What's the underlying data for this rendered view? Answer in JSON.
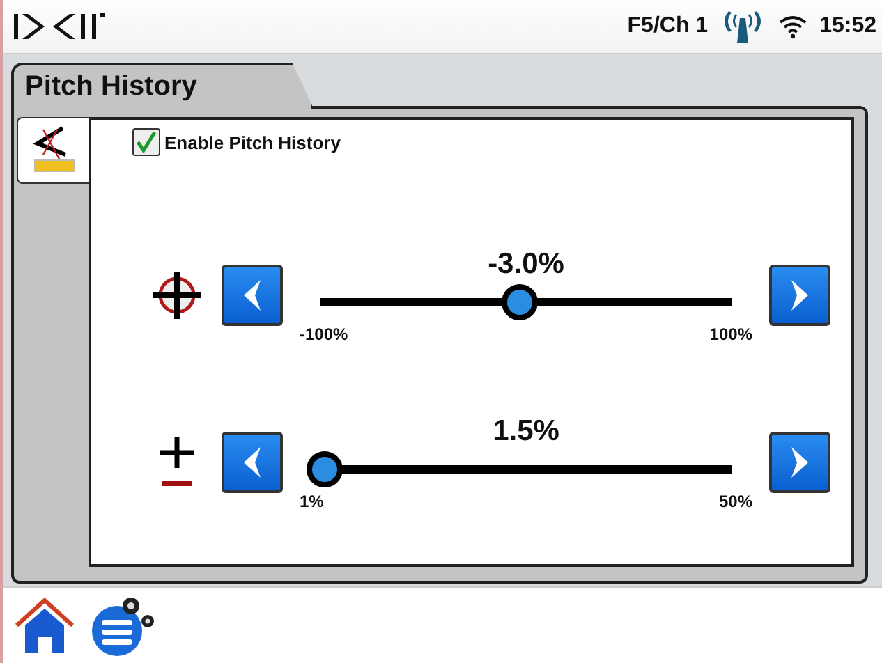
{
  "status_bar": {
    "channel": "F5/Ch 1",
    "time": "15:52"
  },
  "tab": {
    "title": "Pitch History"
  },
  "enable": {
    "label": "Enable Pitch History",
    "checked": true
  },
  "sliders": [
    {
      "kind": "target",
      "value": "-3.0%",
      "min": "-100%",
      "max": "100%",
      "level": 0.485
    },
    {
      "kind": "tolerance",
      "value": "1.5%",
      "min": "1%",
      "max": "50%",
      "level": 0.01
    }
  ]
}
